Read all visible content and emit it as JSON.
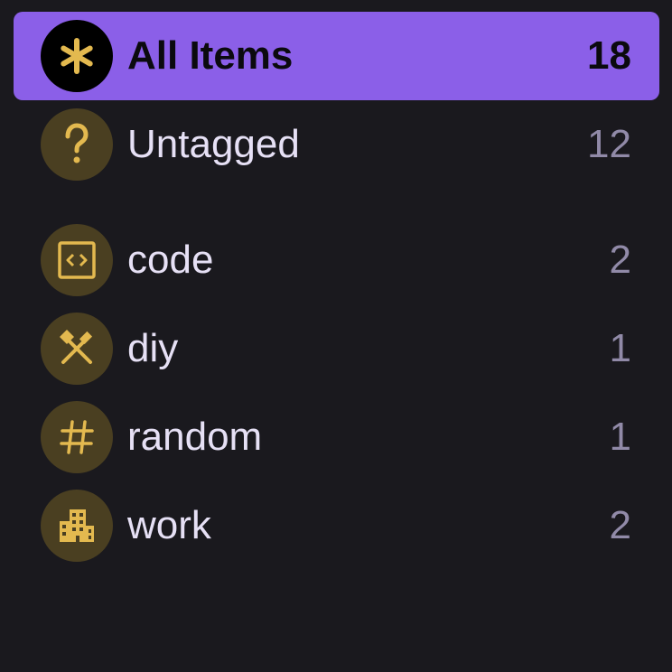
{
  "colors": {
    "background": "#1a191e",
    "selected_row": "#8b5fe8",
    "icon_circle": "#4a3f21",
    "icon_glyph": "#e3b94f",
    "label_text": "#e6e0f5",
    "count_text": "#918aa8"
  },
  "items": [
    {
      "label": "All Items",
      "count": "18",
      "icon": "asterisk-icon",
      "selected": true
    },
    {
      "label": "Untagged",
      "count": "12",
      "icon": "question-mark-icon",
      "selected": false
    },
    {
      "label": "code",
      "count": "2",
      "icon": "code-icon",
      "selected": false
    },
    {
      "label": "diy",
      "count": "1",
      "icon": "tools-icon",
      "selected": false
    },
    {
      "label": "random",
      "count": "1",
      "icon": "hashtag-icon",
      "selected": false
    },
    {
      "label": "work",
      "count": "2",
      "icon": "building-icon",
      "selected": false
    }
  ]
}
